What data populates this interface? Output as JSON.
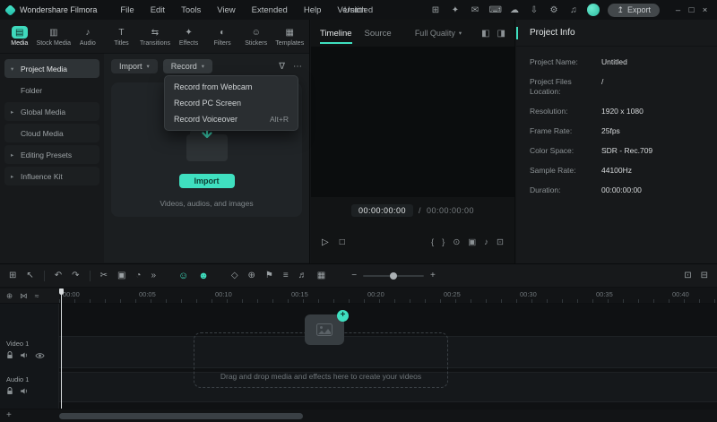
{
  "titlebar": {
    "app_name": "Wondershare Filmora",
    "menus": [
      "File",
      "Edit",
      "Tools",
      "View",
      "Extended",
      "Help",
      "Version"
    ],
    "document_title": "Untitled",
    "icons": [
      {
        "name": "layout-icon",
        "glyph": "⊞"
      },
      {
        "name": "plugin-icon",
        "glyph": "✦"
      },
      {
        "name": "message-icon",
        "glyph": "✉"
      },
      {
        "name": "keyboard-icon",
        "glyph": "⌨"
      },
      {
        "name": "cloud-icon",
        "glyph": "☁"
      },
      {
        "name": "download-icon",
        "glyph": "⇩"
      },
      {
        "name": "settings-icon",
        "glyph": "⚙"
      },
      {
        "name": "media-room-icon",
        "glyph": "♫"
      }
    ],
    "export_icon": "↥",
    "export_label": "Export",
    "window_controls": {
      "minimize": "–",
      "maximize": "□",
      "close": "×"
    }
  },
  "accent_color": "#3fe0c0",
  "media_tabs": [
    {
      "label": "Media",
      "icon": "▤"
    },
    {
      "label": "Stock Media",
      "icon": "▥"
    },
    {
      "label": "Audio",
      "icon": "♪"
    },
    {
      "label": "Titles",
      "icon": "T"
    },
    {
      "label": "Transitions",
      "icon": "⇆"
    },
    {
      "label": "Effects",
      "icon": "✦"
    },
    {
      "label": "Filters",
      "icon": "◐"
    },
    {
      "label": "Stickers",
      "icon": "☺"
    },
    {
      "label": "Templates",
      "icon": "▦"
    }
  ],
  "sidebar": {
    "items": [
      {
        "label": "Project Media",
        "chevron": "▾"
      },
      {
        "label": "Folder",
        "chevron": ""
      },
      {
        "label": "Global Media",
        "chevron": "▸"
      },
      {
        "label": "Cloud Media",
        "chevron": ""
      },
      {
        "label": "Editing Presets",
        "chevron": "▸"
      },
      {
        "label": "Influence Kit",
        "chevron": "▸"
      }
    ]
  },
  "media_panel": {
    "import_button": "Import",
    "record_button": "Record",
    "caret": "▾",
    "filter_icon": "∇",
    "more_icon": "⋯",
    "record_menu": [
      {
        "label": "Record from Webcam",
        "shortcut": ""
      },
      {
        "label": "Record PC Screen",
        "shortcut": ""
      },
      {
        "label": "Record Voiceover",
        "shortcut": "Alt+R"
      }
    ],
    "import_cta": "Import",
    "caption": "Videos, audios, and images"
  },
  "preview": {
    "tabs": [
      {
        "label": "Timeline"
      },
      {
        "label": "Source"
      }
    ],
    "quality": "Full Quality",
    "caret": "▾",
    "header_icons": [
      {
        "name": "compare-view-icon",
        "glyph": "◧"
      },
      {
        "name": "pop-out-icon",
        "glyph": "◨"
      }
    ],
    "time": {
      "current": "00:00:00:00",
      "separator": "/",
      "total": "00:00:00:00"
    },
    "controls": {
      "play": "▷",
      "stop": "□",
      "right": [
        {
          "name": "mark-in-icon",
          "glyph": "{"
        },
        {
          "name": "mark-out-icon",
          "glyph": "}"
        },
        {
          "name": "snapshot-icon",
          "glyph": "⊙"
        },
        {
          "name": "crop-icon",
          "glyph": "▣"
        },
        {
          "name": "volume-icon",
          "glyph": "♪"
        },
        {
          "name": "fullscreen-icon",
          "glyph": "⊡"
        }
      ]
    }
  },
  "project_info": {
    "title": "Project Info",
    "fields": [
      {
        "label": "Project Name:",
        "value": "Untitled"
      },
      {
        "label": "Project Files Location:",
        "value": "/"
      },
      {
        "label": "Resolution:",
        "value": "1920 x 1080"
      },
      {
        "label": "Frame Rate:",
        "value": "25fps"
      },
      {
        "label": "Color Space:",
        "value": "SDR - Rec.709"
      },
      {
        "label": "Sample Rate:",
        "value": "44100Hz"
      },
      {
        "label": "Duration:",
        "value": "00:00:00:00"
      }
    ]
  },
  "timeline": {
    "toolbar": {
      "left_icons": [
        {
          "name": "element-grid-icon",
          "glyph": "⊞"
        },
        {
          "name": "pointer-icon",
          "glyph": "↖"
        },
        {
          "name": "undo-icon",
          "glyph": "↶"
        },
        {
          "name": "redo-icon",
          "glyph": "↷"
        },
        {
          "name": "split-icon",
          "glyph": "✂"
        },
        {
          "name": "crop-icon",
          "glyph": "▣"
        },
        {
          "name": "speed-icon",
          "glyph": "◔"
        },
        {
          "name": "more-tools-icon",
          "glyph": "»"
        }
      ],
      "ai_icons": [
        {
          "name": "ai-portrait-icon",
          "glyph": "☺"
        },
        {
          "name": "ai-mask-icon",
          "glyph": "☻"
        }
      ],
      "mid_icons": [
        {
          "name": "keyframe-icon",
          "glyph": "◇"
        },
        {
          "name": "chroma-key-icon",
          "glyph": "⊕"
        },
        {
          "name": "marker-icon",
          "glyph": "⚑"
        },
        {
          "name": "audio-mixer-icon",
          "glyph": "≡"
        },
        {
          "name": "voiceover-icon",
          "glyph": "♬"
        },
        {
          "name": "render-preview-icon",
          "glyph": "▦"
        }
      ],
      "zoom": {
        "out": "−",
        "in": "+"
      },
      "right_icons": [
        {
          "name": "fit-timeline-icon",
          "glyph": "⊡"
        },
        {
          "name": "track-manager-icon",
          "glyph": "⊟"
        }
      ]
    },
    "header_icons": [
      {
        "name": "add-marker-icon",
        "glyph": "⊕"
      },
      {
        "name": "snap-icon",
        "glyph": "⋈"
      },
      {
        "name": "auto-ripple-icon",
        "glyph": "≈"
      }
    ],
    "ruler": [
      "00:00",
      "00:05",
      "00:10",
      "00:15",
      "00:20",
      "00:25",
      "00:30",
      "00:35",
      "00:40"
    ],
    "tracks": [
      {
        "name": "Video 1"
      },
      {
        "name": "Audio 1"
      }
    ],
    "placeholder_plus": "+",
    "dropzone_text": "Drag and drop media and effects here to create your videos",
    "add_track_icon": "+"
  }
}
